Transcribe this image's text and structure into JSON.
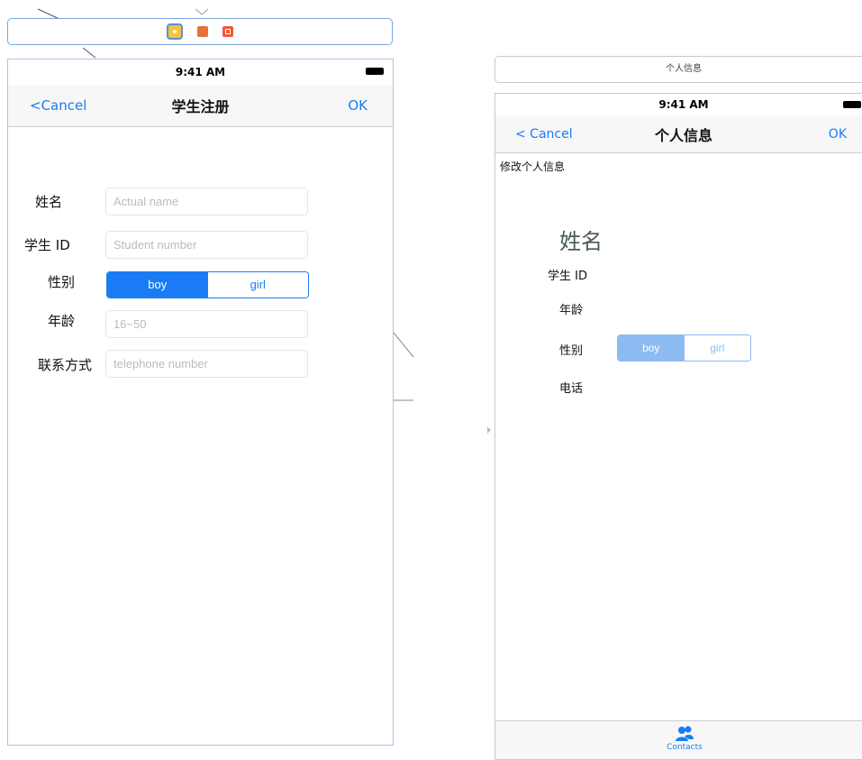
{
  "left_scene": {
    "status_time": "9:41 AM",
    "nav": {
      "cancel_label": "<Cancel",
      "title": "学生注册",
      "ok_label": "OK"
    },
    "form": {
      "name_label": "姓名",
      "name_placeholder": "Actual name",
      "student_id_label": "学生 ID",
      "student_id_placeholder": "Student number",
      "gender_label": "性别",
      "gender_options": [
        "boy",
        "girl"
      ],
      "gender_selected": "boy",
      "age_label": "年龄",
      "age_placeholder": "16~50",
      "contact_label": "联系方式",
      "contact_placeholder": "telephone number"
    }
  },
  "right_scene": {
    "scene_title": "个人信息",
    "status_time": "9:41 AM",
    "nav": {
      "cancel_label": "< Cancel",
      "title": "个人信息",
      "ok_label": "OK"
    },
    "edit_title": "修改个人信息",
    "name_display": "姓名",
    "student_id_label": "学生 ID",
    "age_label": "年龄",
    "gender_label": "性别",
    "gender_options": [
      "boy",
      "girl"
    ],
    "gender_selected": "boy",
    "phone_label": "电话",
    "tab": {
      "icon": "contacts-icon",
      "label": "Contacts"
    }
  },
  "colors": {
    "accent": "#1a7cf5",
    "accent_faded": "#8ebaf2",
    "scene_border": "#7aa7d8"
  }
}
